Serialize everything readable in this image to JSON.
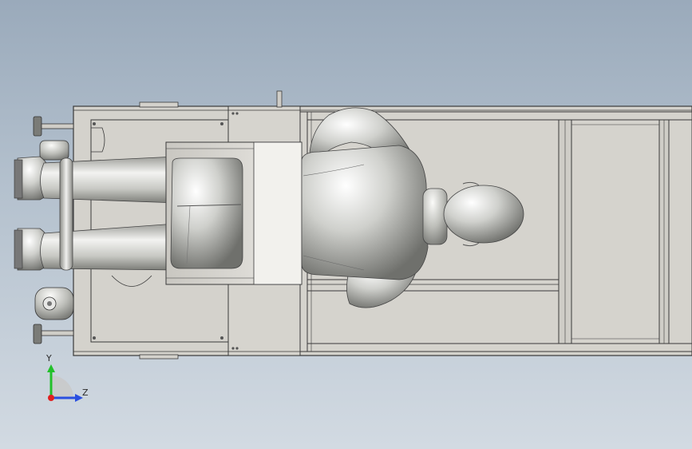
{
  "viewport": {
    "background_top": "#9aaabb",
    "background_bottom": "#d2dae2",
    "model_colors": {
      "frame_fill": "#d4d2cc",
      "frame_stroke": "#3a3a3a",
      "mannequin_light": "#f4f4f2",
      "mannequin_dark": "#6f706c"
    }
  },
  "scene": {
    "model_parts": [
      "frame",
      "base-plate",
      "seat-box",
      "pelvis",
      "torso",
      "left-arm",
      "right-arm",
      "head",
      "left-leg",
      "right-leg",
      "left-foot",
      "right-foot",
      "caster-top",
      "caster-bottom",
      "leveling-feet",
      "rail-track"
    ]
  },
  "triad": {
    "y_label": "Y",
    "z_label": "Z",
    "y_color": "#22c02a",
    "z_color": "#2a4fe0",
    "x_color": "#e02020"
  }
}
